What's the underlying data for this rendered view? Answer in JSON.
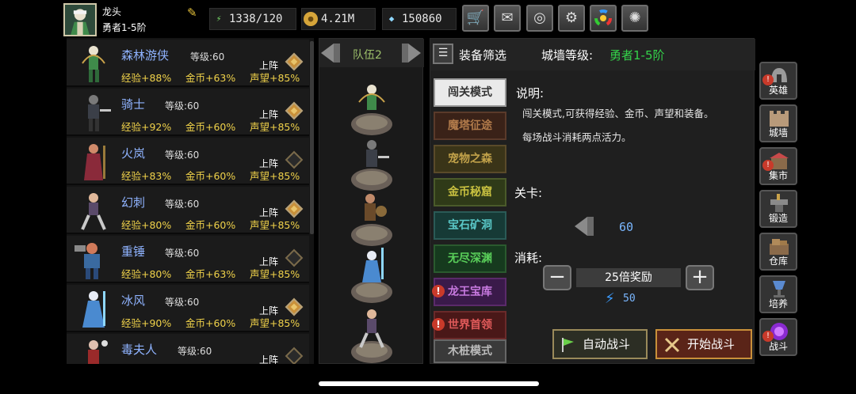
{
  "player": {
    "name": "龙头",
    "rank": "勇者1-5阶"
  },
  "resources": [
    {
      "icon": "energy-icon",
      "value": "1338/120"
    },
    {
      "icon": "gold-coin-icon",
      "value": "4.21M"
    },
    {
      "icon": "gem-icon",
      "value": "150860"
    }
  ],
  "toolbar_icons": [
    "shop-cart-icon",
    "mail-icon",
    "gamepad-icon",
    "settings-gear-icon",
    "color-wheel-icon",
    "fireworks-icon"
  ],
  "heroes": [
    {
      "name": "森林游侠",
      "level": "等级:60",
      "exp": "经验+88%",
      "gold": "金币+63%",
      "fame": "声望+85%",
      "deploy": "上阵",
      "deployed": true
    },
    {
      "name": "骑士",
      "level": "等级:60",
      "exp": "经验+92%",
      "gold": "金币+60%",
      "fame": "声望+85%",
      "deploy": "上阵",
      "deployed": true
    },
    {
      "name": "火岚",
      "level": "等级:60",
      "exp": "经验+83%",
      "gold": "金币+60%",
      "fame": "声望+85%",
      "deploy": "上阵",
      "deployed": false
    },
    {
      "name": "幻刺",
      "level": "等级:60",
      "exp": "经验+80%",
      "gold": "金币+60%",
      "fame": "声望+85%",
      "deploy": "上阵",
      "deployed": true
    },
    {
      "name": "重锤",
      "level": "等级:60",
      "exp": "经验+80%",
      "gold": "金币+63%",
      "fame": "声望+85%",
      "deploy": "上阵",
      "deployed": false
    },
    {
      "name": "冰风",
      "level": "等级:60",
      "exp": "经验+90%",
      "gold": "金币+60%",
      "fame": "声望+85%",
      "deploy": "上阵",
      "deployed": true
    },
    {
      "name": "毒夫人",
      "level": "等级:60",
      "exp": "",
      "gold": "",
      "fame": "",
      "deploy": "上阵",
      "deployed": false
    }
  ],
  "team": {
    "label": "队伍2"
  },
  "main": {
    "filter_label": "装备筛选",
    "wall_label": "城墙等级:",
    "wall_value": "勇者1-5阶",
    "modes": [
      {
        "label": "闯关模式",
        "alert": false
      },
      {
        "label": "魔塔征途",
        "alert": false
      },
      {
        "label": "宠物之森",
        "alert": false
      },
      {
        "label": "金币秘窟",
        "alert": false
      },
      {
        "label": "宝石矿洞",
        "alert": false
      },
      {
        "label": "无尽深渊",
        "alert": false
      },
      {
        "label": "龙王宝库",
        "alert": true
      },
      {
        "label": "世界首领",
        "alert": true
      },
      {
        "label": "木桩模式",
        "alert": false
      }
    ],
    "desc_title": "说明:",
    "desc_lines": [
      "闯关模式,可获得经验、金币、声望和装备。",
      "每场战斗消耗两点活力。"
    ],
    "stage_title": "关卡:",
    "stage_value": "60",
    "cost_title": "消耗:",
    "multiplier": "25倍奖励",
    "energy_cost": "50",
    "auto_battle": "自动战斗",
    "start_battle": "开始战斗"
  },
  "side_menu": [
    {
      "label": "英雄",
      "icon": "helmet-icon",
      "alert": true
    },
    {
      "label": "城墙",
      "icon": "castle-wall-icon",
      "alert": false
    },
    {
      "label": "集市",
      "icon": "market-icon",
      "alert": true
    },
    {
      "label": "锻造",
      "icon": "anvil-icon",
      "alert": false
    },
    {
      "label": "仓库",
      "icon": "warehouse-icon",
      "alert": false
    },
    {
      "label": "培养",
      "icon": "chalice-icon",
      "alert": false
    },
    {
      "label": "战斗",
      "icon": "portal-icon",
      "alert": true
    }
  ],
  "colors": {
    "hero_name": "#8fb3ff",
    "stat_gold": "#f0d24a",
    "wall_green": "#34d24a",
    "team_green": "#9cbf6a",
    "value_blue": "#7ab7ff",
    "alert_red": "#c83a2a"
  }
}
